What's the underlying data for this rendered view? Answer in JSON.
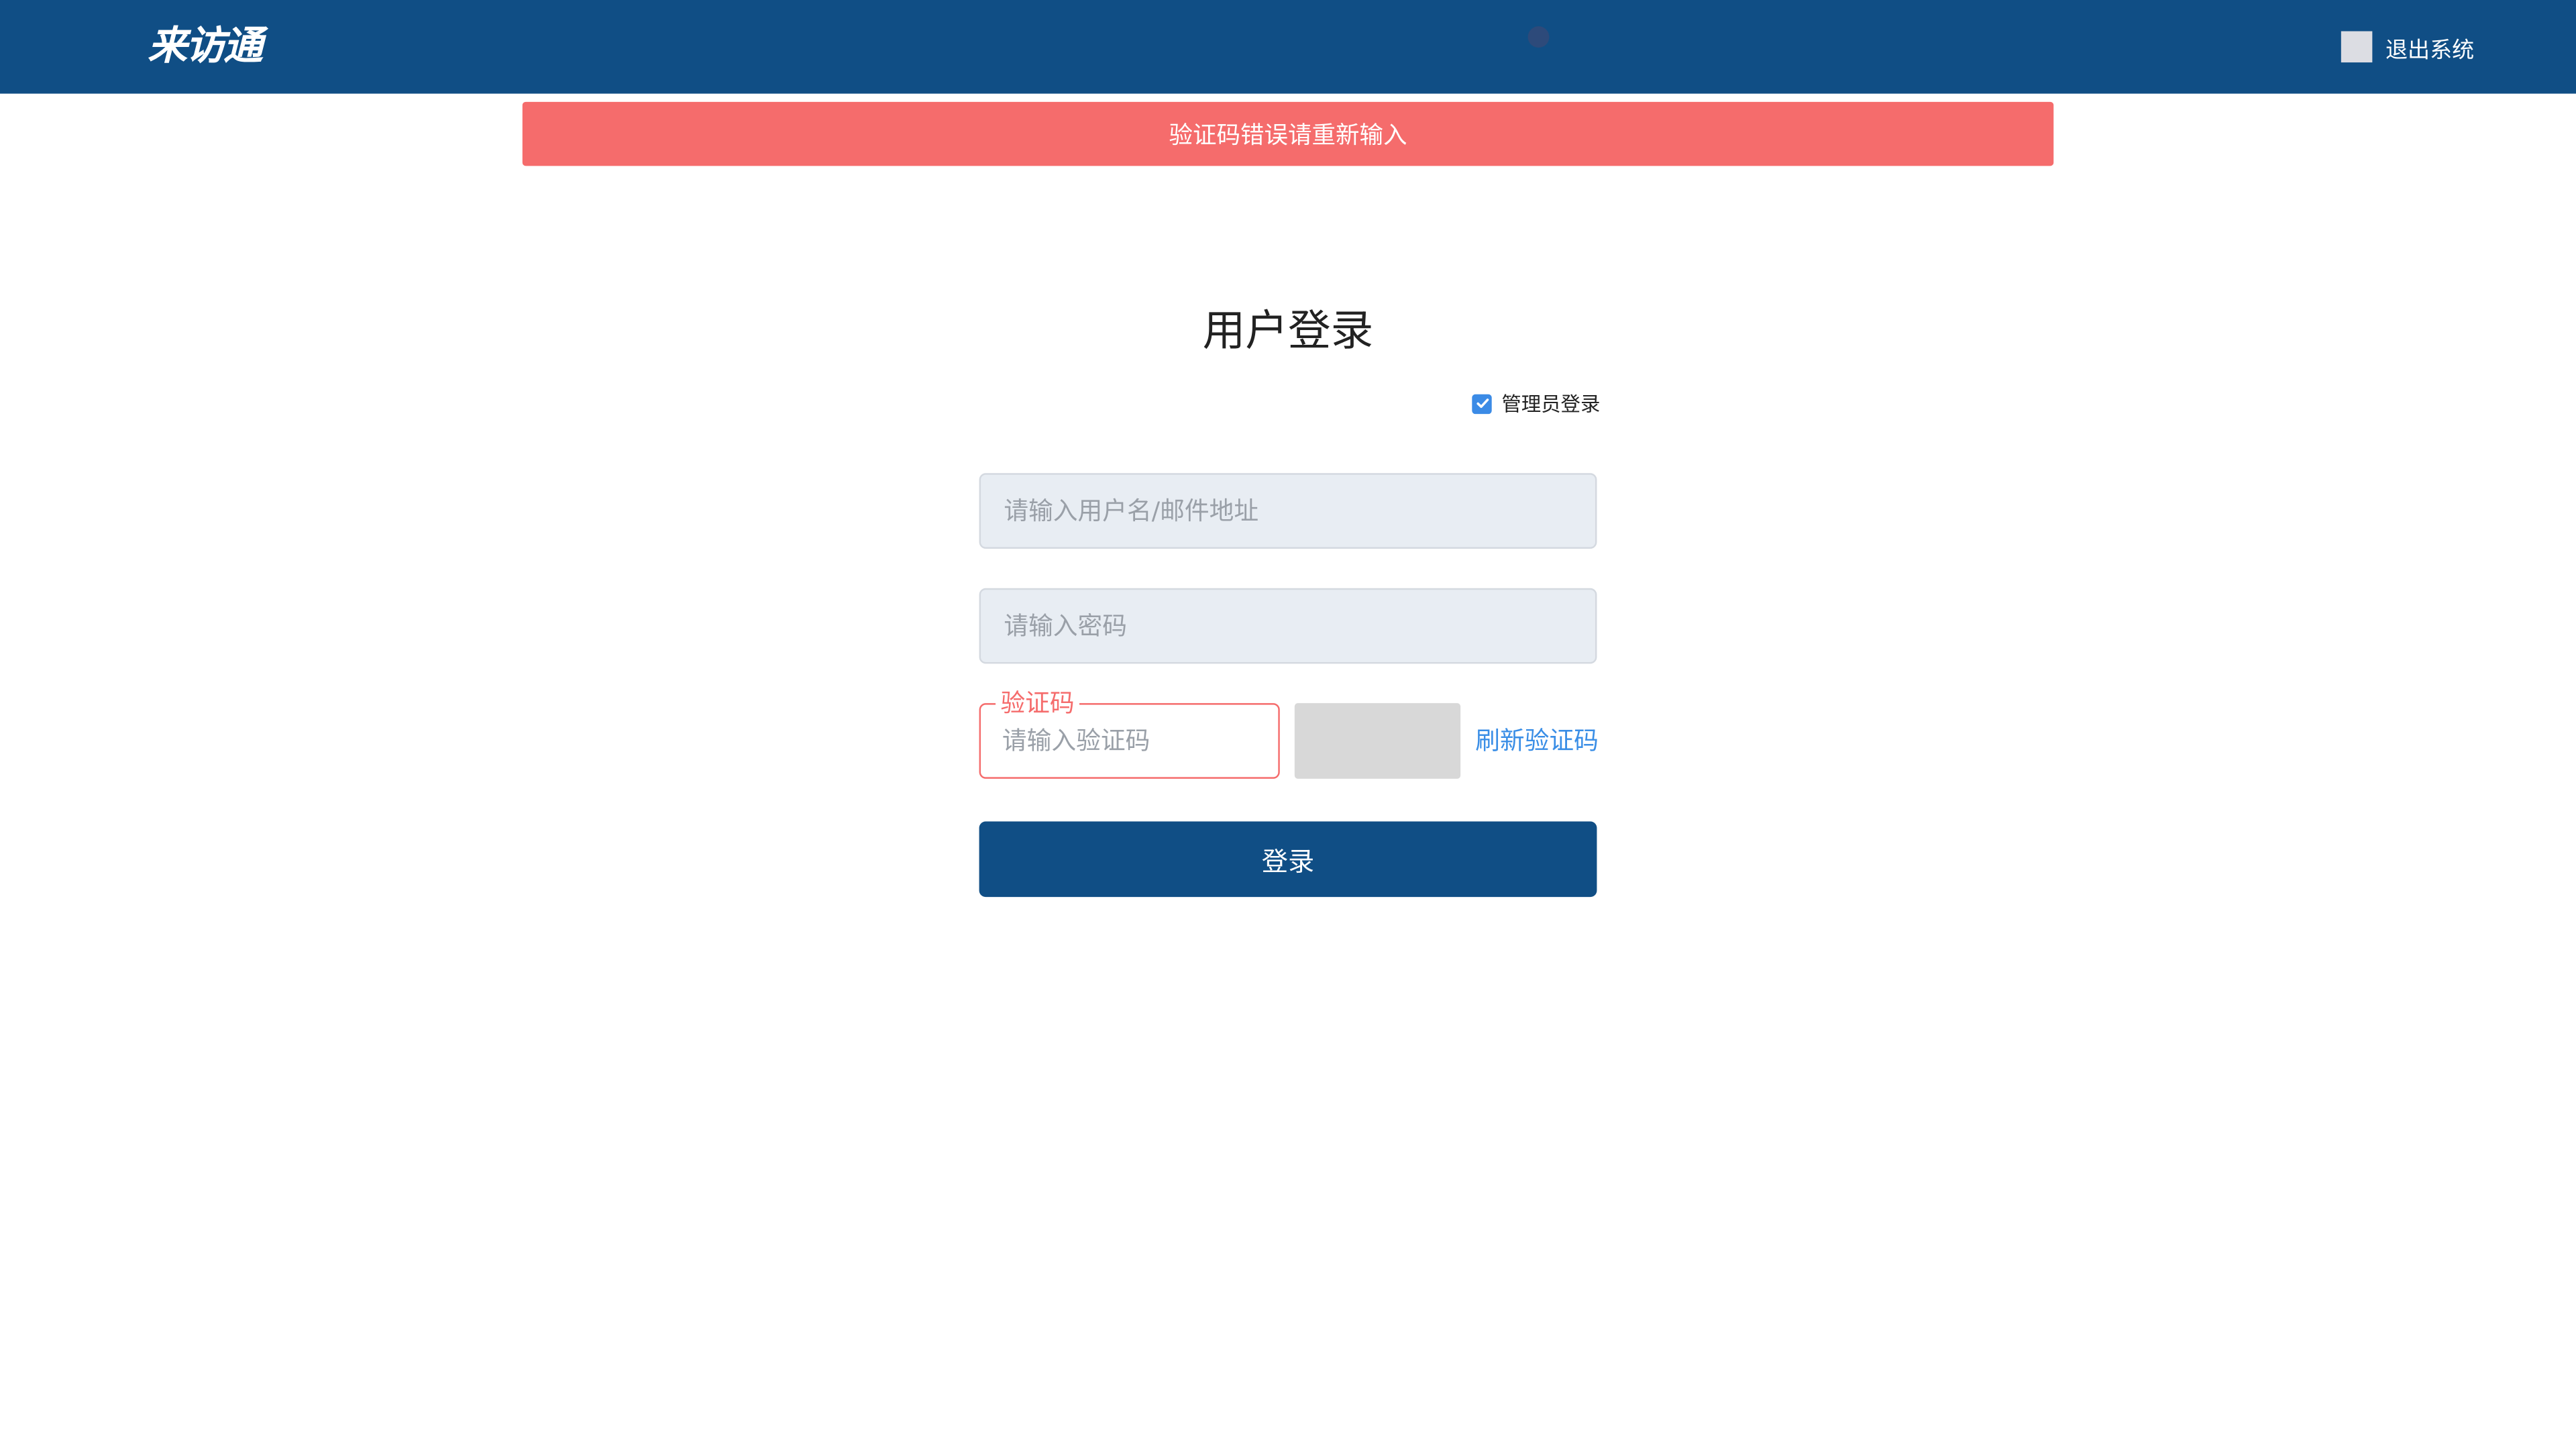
{
  "header": {
    "logo_text": "来访通",
    "logout_label": "退出系统"
  },
  "alert": {
    "message": "验证码错误请重新输入"
  },
  "login": {
    "title": "用户登录",
    "admin_checkbox_label": "管理员登录",
    "admin_checked": true,
    "username_placeholder": "请输入用户名/邮件地址",
    "password_placeholder": "请输入密码",
    "captcha_label": "验证码",
    "captcha_placeholder": "请输入验证码",
    "refresh_captcha": "刷新验证码",
    "submit_label": "登录"
  },
  "colors": {
    "header_bg": "#104e85",
    "alert_bg": "#f56c6c",
    "link": "#3a8ee6",
    "error": "#f56c6c"
  }
}
